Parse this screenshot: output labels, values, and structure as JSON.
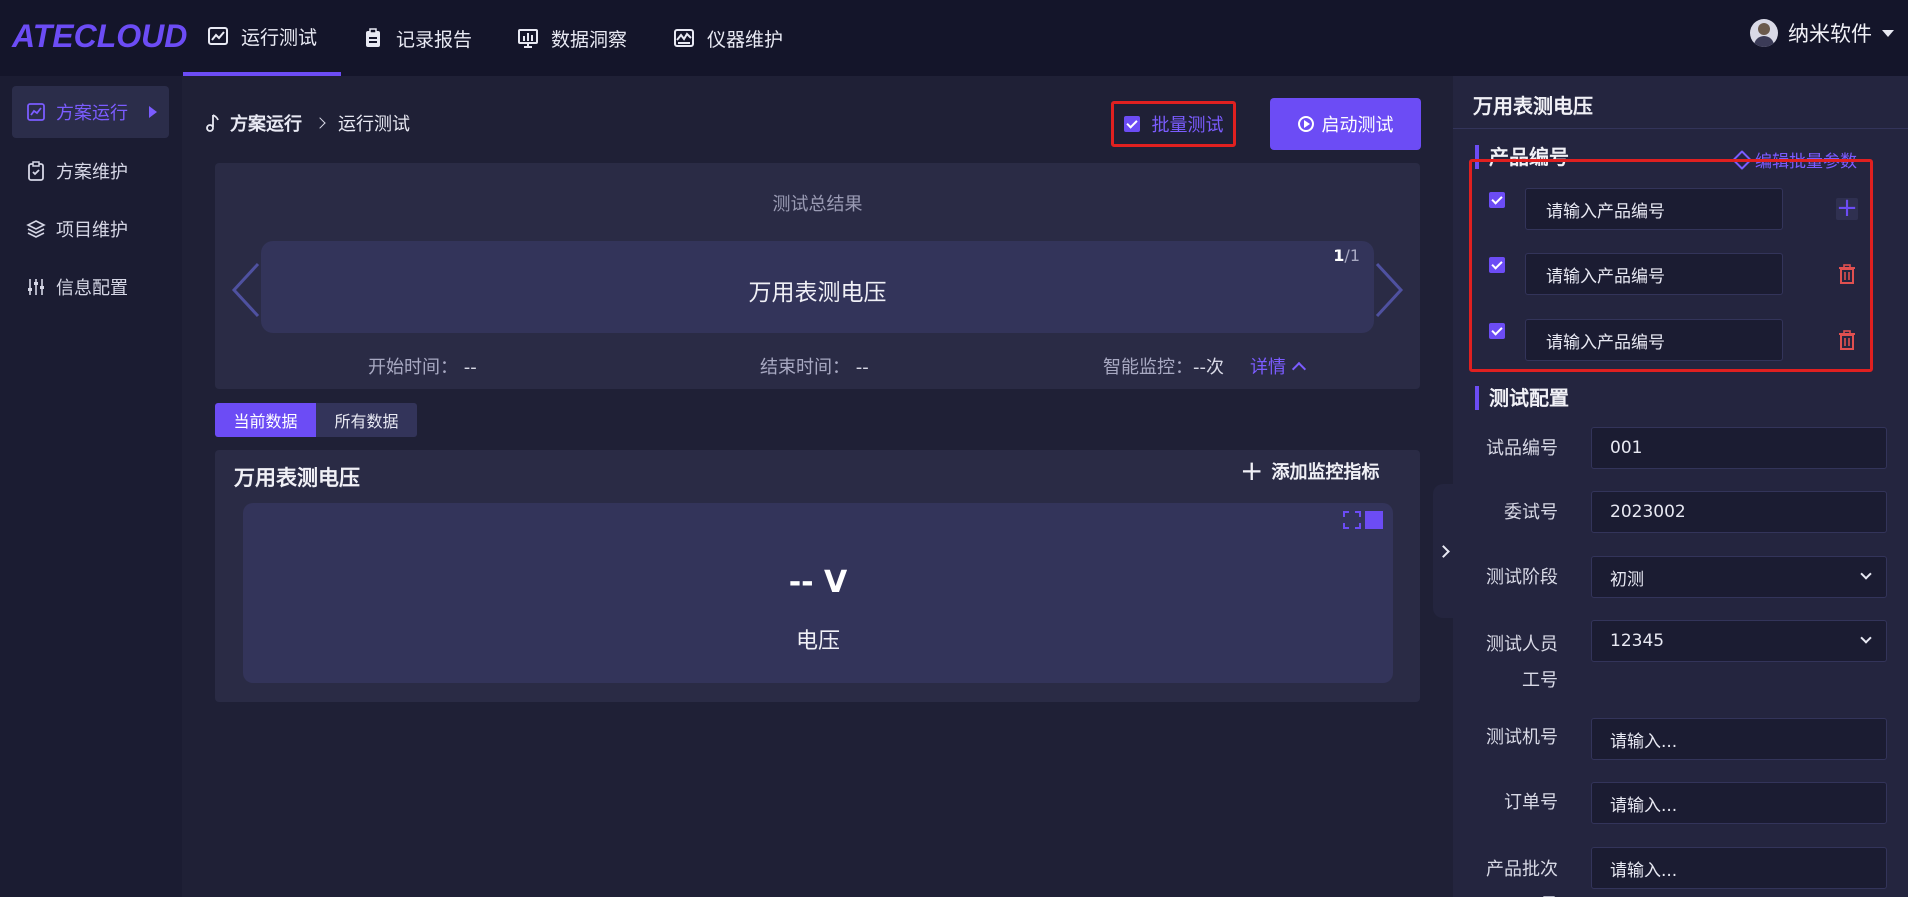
{
  "app": {
    "logo": "ATECLOUD"
  },
  "topnav": [
    {
      "label": "运行测试",
      "icon": "line-chart-icon"
    },
    {
      "label": "记录报告",
      "icon": "clipboard-icon"
    },
    {
      "label": "数据洞察",
      "icon": "monitor-chart-icon"
    },
    {
      "label": "仪器维护",
      "icon": "instrument-icon"
    }
  ],
  "user": {
    "name": "纳米软件"
  },
  "sidebar": [
    {
      "label": "方案运行",
      "icon": "line-chart-icon"
    },
    {
      "label": "方案维护",
      "icon": "clipboard-icon"
    },
    {
      "label": "项目维护",
      "icon": "layers-icon"
    },
    {
      "label": "信息配置",
      "icon": "sliders-icon"
    }
  ],
  "breadcrumb": {
    "root": "方案运行",
    "current": "运行测试"
  },
  "toolbar": {
    "batch_label": "批量测试",
    "start_label": "启动测试"
  },
  "result": {
    "title": "测试总结果",
    "card_name": "万用表测电压",
    "page_current": "1",
    "page_total": "/1",
    "start_label": "开始时间：",
    "start_value": "--",
    "end_label": "结束时间：",
    "end_value": "--",
    "monitor_label": "智能监控：",
    "monitor_value": "--次",
    "detail_label": "详情"
  },
  "tabs": {
    "current": "当前数据",
    "all": "所有数据"
  },
  "monitor": {
    "title": "万用表测电压",
    "add_label": "添加监控指标",
    "value": "-- V",
    "label": "电压"
  },
  "right": {
    "title": "万用表测电压",
    "product_section": "产品编号",
    "edit_batch": "编辑批量参数",
    "product_placeholder": "请输入产品编号",
    "config_section": "测试配置",
    "fields": [
      {
        "label": "试品编号",
        "value": "001"
      },
      {
        "label": "委试号",
        "value": "2023002"
      },
      {
        "label": "测试阶段",
        "value": "初测"
      },
      {
        "label": "测试人员工号",
        "value": "12345"
      },
      {
        "label": "测试机号",
        "value": "请输入..."
      },
      {
        "label": "订单号",
        "value": "请输入..."
      },
      {
        "label": "产品批次号",
        "value": "请输入..."
      }
    ]
  },
  "colors": {
    "accent": "#6c4cf5",
    "highlight": "#e02020",
    "delete": "#e05050"
  }
}
